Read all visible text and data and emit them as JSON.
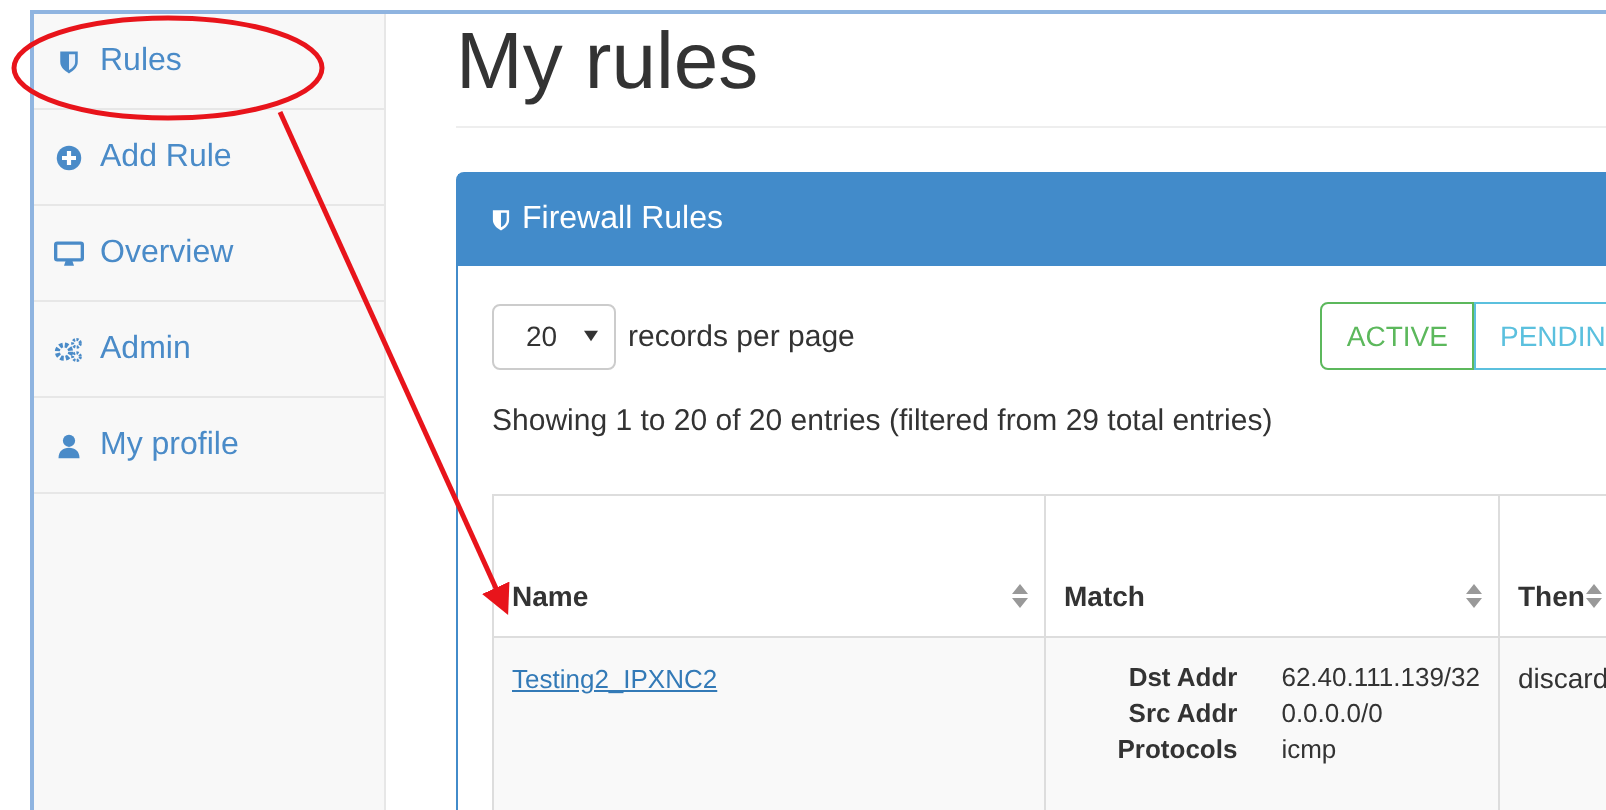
{
  "sidebar": {
    "items": [
      {
        "kind": "shield",
        "label": "Rules"
      },
      {
        "kind": "plus",
        "label": "Add Rule"
      },
      {
        "kind": "monitor",
        "label": "Overview"
      },
      {
        "kind": "gears",
        "label": "Admin"
      },
      {
        "kind": "user",
        "label": "My profile"
      }
    ]
  },
  "page_title": "My rules",
  "panel": {
    "title": "Firewall Rules",
    "page_size": "20",
    "page_size_label": "records per page",
    "filters": [
      {
        "label": "ACTIVE",
        "color": "#5cb85c"
      },
      {
        "label": "PENDIN",
        "color": "#5bc0de"
      }
    ],
    "info": "Showing 1 to 20 of 20 entries (filtered from 29 total entries)",
    "table": {
      "columns": [
        "Name",
        "Match",
        "Then"
      ],
      "rows": [
        {
          "name": "Testing2_IPXNC2",
          "match": [
            {
              "key": "Dst Addr",
              "value": "62.40.111.139/32"
            },
            {
              "key": "Src Addr",
              "value": "0.0.0.0/0"
            },
            {
              "key": "Protocols",
              "value": "icmp"
            }
          ],
          "then": "discard"
        }
      ]
    }
  }
}
